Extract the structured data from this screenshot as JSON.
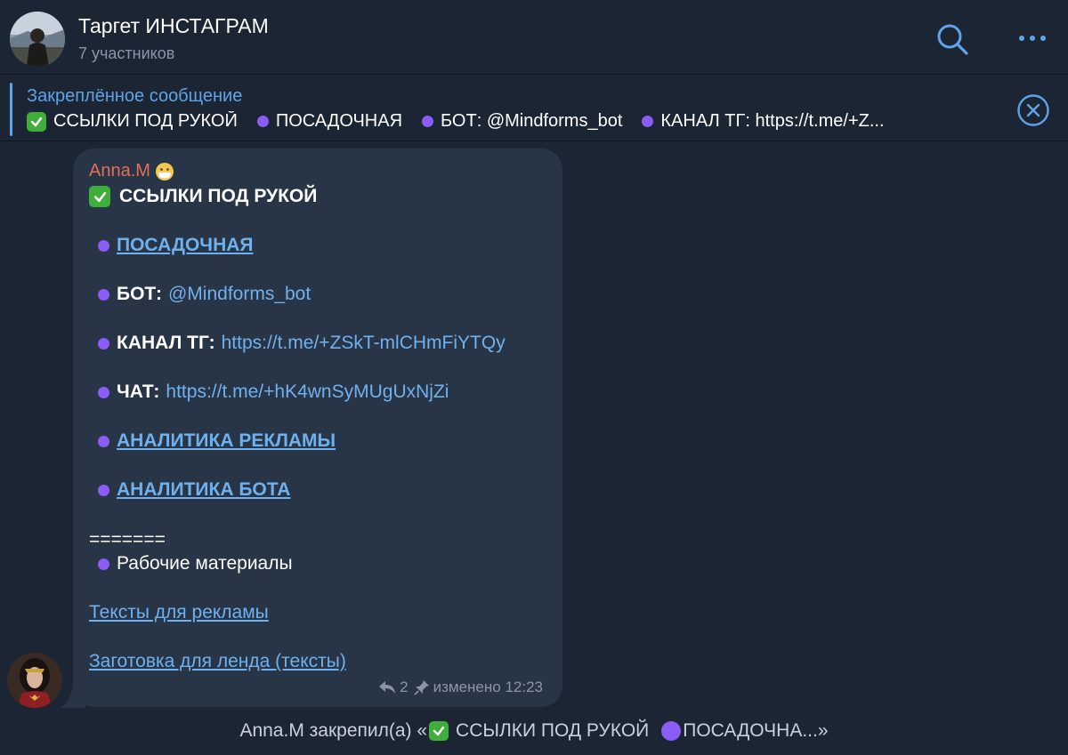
{
  "header": {
    "title": "Таргет ИНСТАГРАМ",
    "subtitle": "7 участников",
    "search_icon": "search-icon",
    "more_icon": "more-icon"
  },
  "pinned": {
    "label": "Закреплённое сообщение",
    "seg1": "ССЫЛКИ ПОД РУКОЙ",
    "seg2": "ПОСАДОЧНАЯ",
    "seg3": "БОТ: @Mindforms_bot",
    "seg4": "КАНАЛ ТГ: https://t.me/+Z..."
  },
  "message": {
    "sender": "Anna.M",
    "heading": "ССЫЛКИ ПОД РУКОЙ",
    "items": [
      {
        "link": "ПОСАДОЧНАЯ"
      },
      {
        "label": "БОТ:",
        "value": "@Mindforms_bot"
      },
      {
        "label": "КАНАЛ ТГ:",
        "value": "https://t.me/+ZSkT-mlCHmFiYTQy"
      },
      {
        "label": "ЧАТ:",
        "value": "https://t.me/+hK4wnSyMUgUxNjZi"
      },
      {
        "link": "АНАЛИТИКА РЕКЛАМЫ"
      },
      {
        "link": "АНАЛИТИКА БОТА"
      }
    ],
    "separator": "=======",
    "materials": "Рабочие материалы",
    "link_texts": "Тексты для рекламы",
    "link_landing": "Заготовка для ленда (тексты)",
    "replies": "2",
    "edited": "изменено 12:23"
  },
  "service": {
    "prefix": "Anna.M закрепил(а) «",
    "middle": "ССЫЛКИ ПОД РУКОЙ",
    "suffix": "ПОСАДОЧНА...»"
  },
  "colors": {
    "background": "#1c2534",
    "bubble": "#283546",
    "accent": "#5fa4e6",
    "link": "#6fb1ee",
    "sender": "#e46e5c",
    "bullet": "#8b5cf6",
    "check": "#3fae3a"
  }
}
